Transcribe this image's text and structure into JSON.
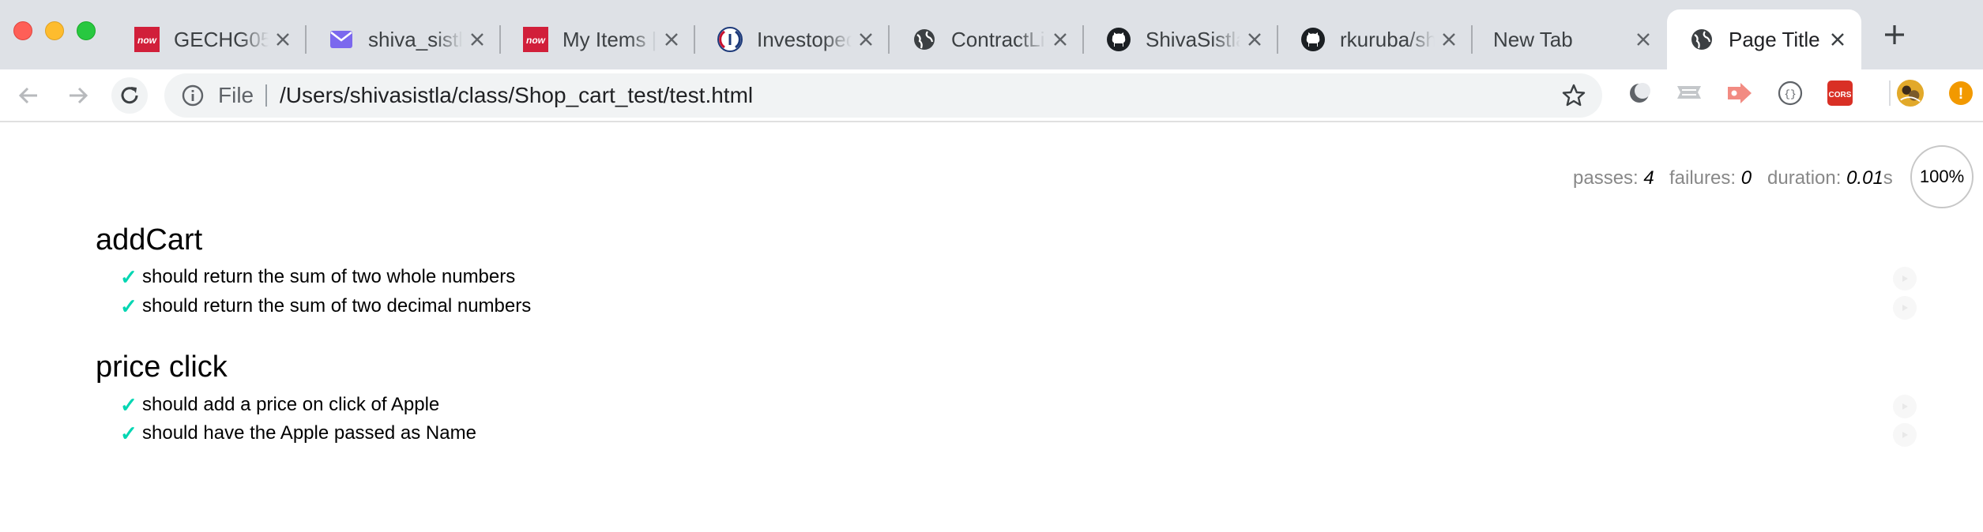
{
  "window": {
    "traffic_lights": [
      "close",
      "minimize",
      "maximize"
    ]
  },
  "tabs": [
    {
      "title": "GECHG05",
      "favicon": "servicenow-now-icon",
      "active": false
    },
    {
      "title": "shiva_sistla",
      "favicon": "mail-envelope-icon",
      "active": false
    },
    {
      "title": "My Items |",
      "favicon": "servicenow-now-icon",
      "active": false
    },
    {
      "title": "Investopedia",
      "favicon": "investopedia-icon",
      "active": false
    },
    {
      "title": "ContractLi",
      "favicon": "globe-icon",
      "active": false
    },
    {
      "title": "ShivaSistla",
      "favicon": "github-icon",
      "active": false
    },
    {
      "title": "rkuruba/sh",
      "favicon": "github-icon",
      "active": false
    },
    {
      "title": "New Tab",
      "favicon": "",
      "active": false
    },
    {
      "title": "Page Title",
      "favicon": "globe-icon",
      "active": true
    }
  ],
  "toolbar": {
    "scheme_label": "File",
    "url": "/Users/shivasistla/class/Shop_cart_test/test.html",
    "extensions": [
      "moon-extension-icon",
      "ribbon-extension-icon",
      "arrow-extension-icon",
      "braces-extension-icon",
      "cors-extension-icon",
      "avatar-extension-icon",
      "alert-extension-icon"
    ],
    "cors_text": "CORS",
    "alert_text": "!"
  },
  "report": {
    "stats": {
      "passes_label": "passes:",
      "passes": "4",
      "failures_label": "failures:",
      "failures": "0",
      "duration_label": "duration:",
      "duration": "0.01",
      "duration_unit": "s",
      "progress": "100%"
    },
    "suites": [
      {
        "title": "addCart",
        "tests": [
          {
            "status": "passed",
            "check": "✓",
            "title": "should return the sum of two whole numbers"
          },
          {
            "status": "passed",
            "check": "✓",
            "title": "should return the sum of two decimal numbers"
          }
        ]
      },
      {
        "title": "price click",
        "tests": [
          {
            "status": "passed",
            "check": "✓",
            "title": "should add a price on click of Apple"
          },
          {
            "status": "passed",
            "check": "✓",
            "title": "should have the Apple passed as Name"
          }
        ]
      }
    ]
  },
  "colors": {
    "tabstrip_bg": "#dee1e6",
    "pass_check": "#00d6b2",
    "stats_label": "#888888"
  }
}
